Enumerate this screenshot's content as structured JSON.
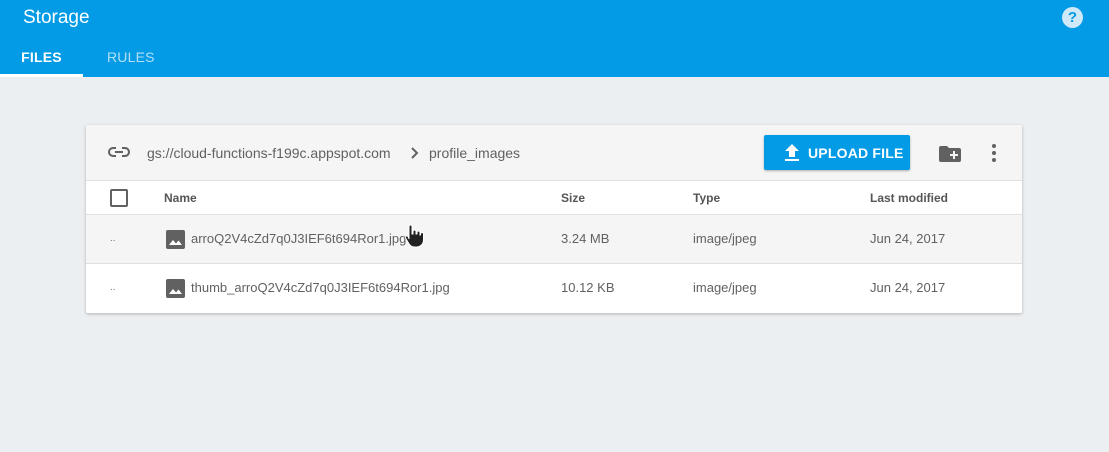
{
  "header": {
    "title": "Storage",
    "help_icon": "help-circle-icon",
    "help_glyph": "?",
    "tabs": [
      {
        "label": "FILES",
        "active": true
      },
      {
        "label": "RULES",
        "active": false
      }
    ],
    "accent_color": "#039be5"
  },
  "breadcrumb": {
    "link_icon": "link-icon",
    "bucket": "gs://cloud-functions-f199c.appspot.com",
    "separator_icon": "chevron-right-icon",
    "folder": "profile_images"
  },
  "toolbar": {
    "upload_label": "UPLOAD FILE",
    "upload_icon": "upload-icon",
    "new_folder_icon": "create-new-folder-icon",
    "more_icon": "more-vert-icon"
  },
  "table": {
    "columns": [
      "Name",
      "Size",
      "Type",
      "Last modified"
    ],
    "rows": [
      {
        "marker": "..",
        "icon": "image-icon",
        "name": "arroQ2V4cZd7q0J3IEF6t694Ror1.jpg",
        "size": "3.24 MB",
        "type": "image/jpeg",
        "modified": "Jun 24, 2017"
      },
      {
        "marker": "..",
        "icon": "image-icon",
        "name": "thumb_arroQ2V4cZd7q0J3IEF6t694Ror1.jpg",
        "size": "10.12 KB",
        "type": "image/jpeg",
        "modified": "Jun 24, 2017"
      }
    ]
  }
}
